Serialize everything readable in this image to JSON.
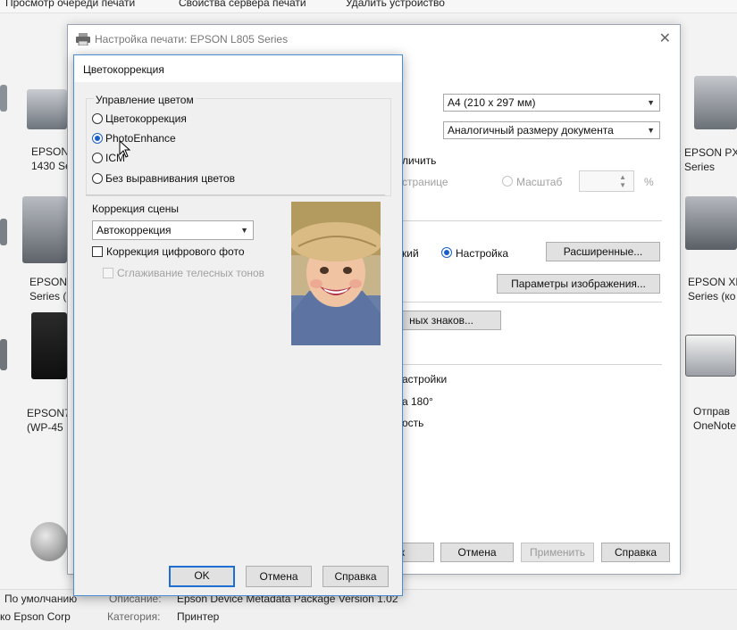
{
  "topbar": {
    "items": [
      "Просмотр очереди печати",
      "Свойства сервера печати",
      "Удалить устройство"
    ]
  },
  "devices_left": [
    {
      "line1": "EPSON",
      "line2": "1430 Se"
    },
    {
      "line1": "EPSON",
      "line2": "Series ("
    },
    {
      "line1": "EPSON7",
      "line2": "(WP-45"
    }
  ],
  "devices_right": [
    {
      "line1": "EPSON PX",
      "line2": "Series"
    },
    {
      "line1": "EPSON XP",
      "line2": "Series (ко"
    },
    {
      "line1": "Отправ",
      "line2": "OneNote"
    }
  ],
  "status": {
    "default_text": "По умолчанию",
    "vendor_text": "ко Epson Corp",
    "desc_key": "Описание:",
    "desc_value": "Epson Device Metadata Package Version 1.02",
    "category_key": "Категория:",
    "category_value": "Принтер"
  },
  "print_dialog": {
    "title": "Настройка печати: EPSON L805 Series",
    "paper_size": "A4 (210 x 297 мм)",
    "output_size": "Аналогичный размеру документа",
    "enlarge_label": "личить",
    "fit_page_label": "странице",
    "scale_label": "Масштаб",
    "percent": "%",
    "mode_label": "кий",
    "custom_label": "Настройка",
    "advanced_button": "Расширенные...",
    "image_params_button": "Параметры изображения...",
    "watermark_button": "ных знаков...",
    "extra_settings_label": "астройки",
    "rotate_label": "а 180°",
    "speed_label": "ость",
    "ok_partial": "к",
    "cancel_button": "Отмена",
    "apply_button": "Применить",
    "help_button": "Справка"
  },
  "color_dialog": {
    "title": "Цветокоррекция",
    "group_label": "Управление цветом",
    "radio_options": [
      "Цветокоррекция",
      "PhotoEnhance",
      "ICM",
      "Без выравнивания цветов"
    ],
    "selected_option": "PhotoEnhance",
    "scene_label": "Коррекция сцены",
    "scene_value": "Автокоррекция",
    "digital_photo_label": "Коррекция цифрового фото",
    "skin_smoothing_label": "Сглаживание телесных тонов",
    "ok_button": "OK",
    "cancel_button": "Отмена",
    "help_button": "Справка"
  },
  "colors": {
    "accent": "#1e6fd1",
    "dialog_border": "#4a8fd6"
  }
}
